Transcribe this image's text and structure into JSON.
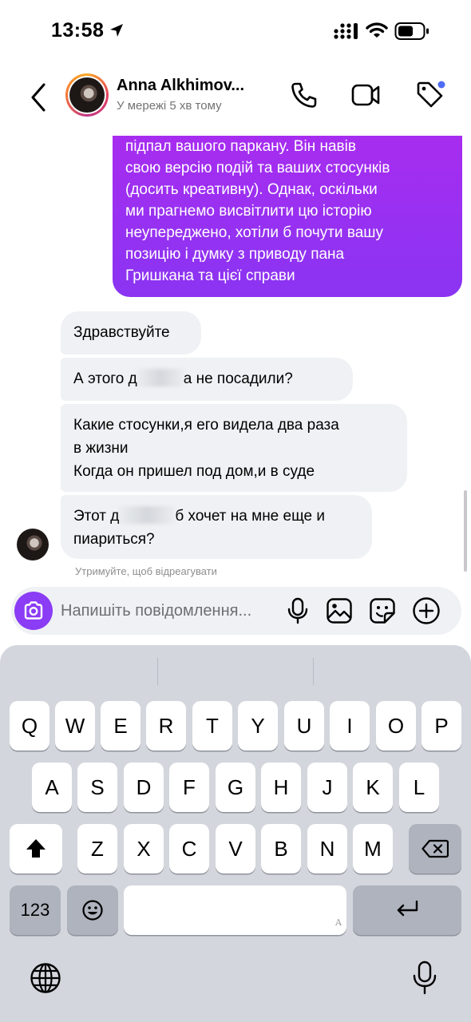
{
  "status_bar": {
    "time": "13:58"
  },
  "header": {
    "contact_name": "Anna Alkhimov...",
    "contact_status": "У мережі 5 хв тому"
  },
  "messages": {
    "sent": {
      "lines": [
        "підпал вашого паркану. Він навів",
        "свою версію подій та ваших стосунків",
        "(досить креативну). Однак, оскільки",
        "ми прагнемо висвітлити цю історію",
        "неупереджено, хотіли б почути вашу",
        "позицію і думку з приводу пана",
        "Гришкана та цієї справи"
      ]
    },
    "received": [
      {
        "text": "Здравствуйте"
      },
      {
        "before": "А этого д",
        "after": "а не посадили?"
      },
      {
        "lines": [
          "Какие стосунки,я его видела два раза",
          "в жизни",
          "Когда он пришел под дом,и в суде"
        ]
      },
      {
        "before": "Этот д",
        "after": "б хочет на мне еще и",
        "line2": "пиариться?"
      }
    ],
    "hold_hint": "Утримуйте, щоб відреагувати"
  },
  "composer": {
    "placeholder": "Напишіть повідомлення..."
  },
  "keyboard": {
    "row1": [
      "Q",
      "W",
      "E",
      "R",
      "T",
      "Y",
      "U",
      "I",
      "O",
      "P"
    ],
    "row2": [
      "A",
      "S",
      "D",
      "F",
      "G",
      "H",
      "J",
      "K",
      "L"
    ],
    "row3": [
      "Z",
      "X",
      "C",
      "V",
      "B",
      "N",
      "M"
    ],
    "numbers_label": "123",
    "space_hint": "A"
  },
  "colors": {
    "accent": "#8b3cf5",
    "sent_bubble_top": "#a92cf0",
    "sent_bubble_bottom": "#8a34f2",
    "received_bubble": "#eff1f4",
    "notification_dot": "#4f6cf5"
  },
  "icons": [
    "location-arrow-icon",
    "signal-icon",
    "wifi-icon",
    "battery-icon",
    "back-icon",
    "phone-icon",
    "video-icon",
    "tag-icon",
    "camera-icon",
    "microphone-icon",
    "gallery-icon",
    "sticker-icon",
    "plus-icon",
    "shift-icon",
    "backspace-icon",
    "emoji-icon",
    "return-icon",
    "globe-icon",
    "dictation-icon"
  ]
}
